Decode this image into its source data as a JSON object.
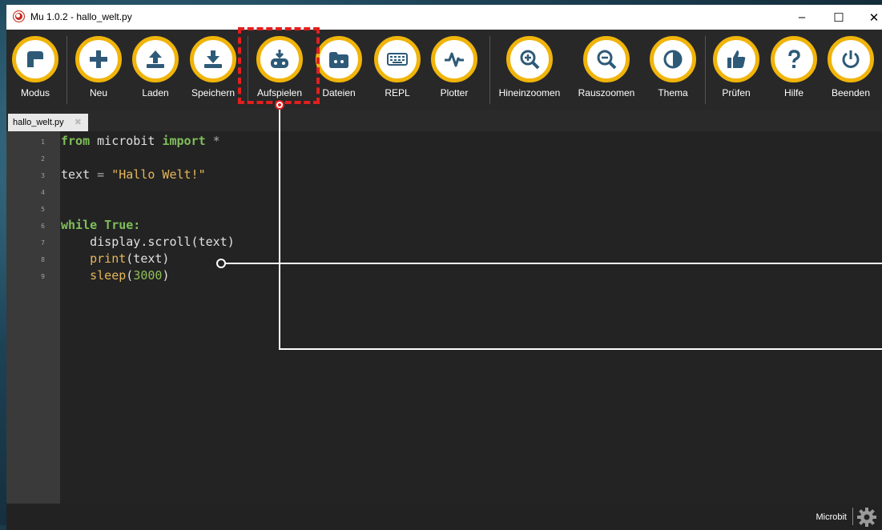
{
  "window": {
    "title": "Mu 1.0.2 - hallo_welt.py",
    "controls": {
      "minimize": "–",
      "maximize": "☐",
      "close": "✕"
    }
  },
  "toolbar": {
    "buttons": [
      {
        "label": "Modus",
        "icon": "mode-icon"
      },
      {
        "label": "Neu",
        "icon": "plus-icon"
      },
      {
        "label": "Laden",
        "icon": "upload-icon"
      },
      {
        "label": "Speichern",
        "icon": "download-icon"
      },
      {
        "label": "Aufspielen",
        "icon": "flash-microbit-icon"
      },
      {
        "label": "Dateien",
        "icon": "files-icon"
      },
      {
        "label": "REPL",
        "icon": "keyboard-icon"
      },
      {
        "label": "Plotter",
        "icon": "pulse-icon"
      },
      {
        "label": "Hineinzoomen",
        "icon": "zoom-in-icon"
      },
      {
        "label": "Rauszoomen",
        "icon": "zoom-out-icon"
      },
      {
        "label": "Thema",
        "icon": "contrast-icon"
      },
      {
        "label": "Prüfen",
        "icon": "thumbs-up-icon"
      },
      {
        "label": "Hilfe",
        "icon": "question-icon"
      },
      {
        "label": "Beenden",
        "icon": "power-icon"
      }
    ]
  },
  "tabs": [
    {
      "label": "hallo_welt.py"
    }
  ],
  "editor": {
    "line_numbers": [
      "1",
      "2",
      "3",
      "4",
      "5",
      "6",
      "7",
      "8",
      "9"
    ],
    "lines": {
      "l1_kw1": "from",
      "l1_mod": " microbit ",
      "l1_kw2": "import",
      "l1_star": " *",
      "l3_var": "text ",
      "l3_op": "=",
      "l3_str": " \"Hallo Welt!\"",
      "l6_kw": "while True:",
      "l7_code": "    display.scroll(text)",
      "l8_fn": "    print",
      "l8_rest": "(text)",
      "l9_fn": "    sleep",
      "l9_p1": "(",
      "l9_num": "3000",
      "l9_p2": ")"
    }
  },
  "status": {
    "mode": "Microbit"
  },
  "colors": {
    "accent": "#f0b40a",
    "highlight": "#e21e1e",
    "keyword": "#7fbf5a",
    "string": "#e6b75a"
  }
}
